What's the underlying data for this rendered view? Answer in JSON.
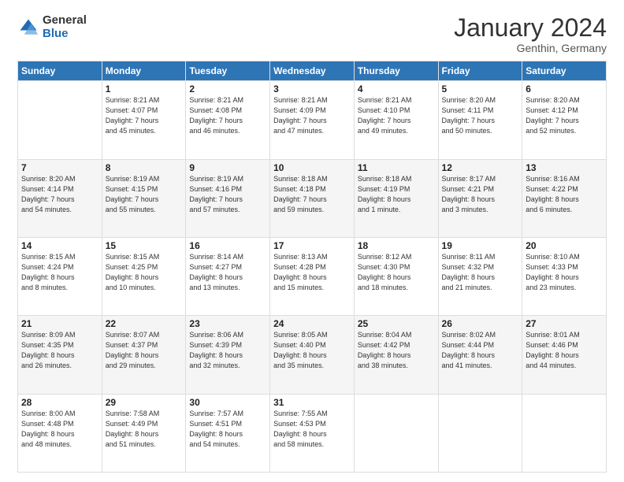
{
  "logo": {
    "general": "General",
    "blue": "Blue"
  },
  "title": "January 2024",
  "location": "Genthin, Germany",
  "days_header": [
    "Sunday",
    "Monday",
    "Tuesday",
    "Wednesday",
    "Thursday",
    "Friday",
    "Saturday"
  ],
  "weeks": [
    [
      {
        "day": "",
        "info": ""
      },
      {
        "day": "1",
        "info": "Sunrise: 8:21 AM\nSunset: 4:07 PM\nDaylight: 7 hours\nand 45 minutes."
      },
      {
        "day": "2",
        "info": "Sunrise: 8:21 AM\nSunset: 4:08 PM\nDaylight: 7 hours\nand 46 minutes."
      },
      {
        "day": "3",
        "info": "Sunrise: 8:21 AM\nSunset: 4:09 PM\nDaylight: 7 hours\nand 47 minutes."
      },
      {
        "day": "4",
        "info": "Sunrise: 8:21 AM\nSunset: 4:10 PM\nDaylight: 7 hours\nand 49 minutes."
      },
      {
        "day": "5",
        "info": "Sunrise: 8:20 AM\nSunset: 4:11 PM\nDaylight: 7 hours\nand 50 minutes."
      },
      {
        "day": "6",
        "info": "Sunrise: 8:20 AM\nSunset: 4:12 PM\nDaylight: 7 hours\nand 52 minutes."
      }
    ],
    [
      {
        "day": "7",
        "info": "Sunrise: 8:20 AM\nSunset: 4:14 PM\nDaylight: 7 hours\nand 54 minutes."
      },
      {
        "day": "8",
        "info": "Sunrise: 8:19 AM\nSunset: 4:15 PM\nDaylight: 7 hours\nand 55 minutes."
      },
      {
        "day": "9",
        "info": "Sunrise: 8:19 AM\nSunset: 4:16 PM\nDaylight: 7 hours\nand 57 minutes."
      },
      {
        "day": "10",
        "info": "Sunrise: 8:18 AM\nSunset: 4:18 PM\nDaylight: 7 hours\nand 59 minutes."
      },
      {
        "day": "11",
        "info": "Sunrise: 8:18 AM\nSunset: 4:19 PM\nDaylight: 8 hours\nand 1 minute."
      },
      {
        "day": "12",
        "info": "Sunrise: 8:17 AM\nSunset: 4:21 PM\nDaylight: 8 hours\nand 3 minutes."
      },
      {
        "day": "13",
        "info": "Sunrise: 8:16 AM\nSunset: 4:22 PM\nDaylight: 8 hours\nand 6 minutes."
      }
    ],
    [
      {
        "day": "14",
        "info": "Sunrise: 8:15 AM\nSunset: 4:24 PM\nDaylight: 8 hours\nand 8 minutes."
      },
      {
        "day": "15",
        "info": "Sunrise: 8:15 AM\nSunset: 4:25 PM\nDaylight: 8 hours\nand 10 minutes."
      },
      {
        "day": "16",
        "info": "Sunrise: 8:14 AM\nSunset: 4:27 PM\nDaylight: 8 hours\nand 13 minutes."
      },
      {
        "day": "17",
        "info": "Sunrise: 8:13 AM\nSunset: 4:28 PM\nDaylight: 8 hours\nand 15 minutes."
      },
      {
        "day": "18",
        "info": "Sunrise: 8:12 AM\nSunset: 4:30 PM\nDaylight: 8 hours\nand 18 minutes."
      },
      {
        "day": "19",
        "info": "Sunrise: 8:11 AM\nSunset: 4:32 PM\nDaylight: 8 hours\nand 21 minutes."
      },
      {
        "day": "20",
        "info": "Sunrise: 8:10 AM\nSunset: 4:33 PM\nDaylight: 8 hours\nand 23 minutes."
      }
    ],
    [
      {
        "day": "21",
        "info": "Sunrise: 8:09 AM\nSunset: 4:35 PM\nDaylight: 8 hours\nand 26 minutes."
      },
      {
        "day": "22",
        "info": "Sunrise: 8:07 AM\nSunset: 4:37 PM\nDaylight: 8 hours\nand 29 minutes."
      },
      {
        "day": "23",
        "info": "Sunrise: 8:06 AM\nSunset: 4:39 PM\nDaylight: 8 hours\nand 32 minutes."
      },
      {
        "day": "24",
        "info": "Sunrise: 8:05 AM\nSunset: 4:40 PM\nDaylight: 8 hours\nand 35 minutes."
      },
      {
        "day": "25",
        "info": "Sunrise: 8:04 AM\nSunset: 4:42 PM\nDaylight: 8 hours\nand 38 minutes."
      },
      {
        "day": "26",
        "info": "Sunrise: 8:02 AM\nSunset: 4:44 PM\nDaylight: 8 hours\nand 41 minutes."
      },
      {
        "day": "27",
        "info": "Sunrise: 8:01 AM\nSunset: 4:46 PM\nDaylight: 8 hours\nand 44 minutes."
      }
    ],
    [
      {
        "day": "28",
        "info": "Sunrise: 8:00 AM\nSunset: 4:48 PM\nDaylight: 8 hours\nand 48 minutes."
      },
      {
        "day": "29",
        "info": "Sunrise: 7:58 AM\nSunset: 4:49 PM\nDaylight: 8 hours\nand 51 minutes."
      },
      {
        "day": "30",
        "info": "Sunrise: 7:57 AM\nSunset: 4:51 PM\nDaylight: 8 hours\nand 54 minutes."
      },
      {
        "day": "31",
        "info": "Sunrise: 7:55 AM\nSunset: 4:53 PM\nDaylight: 8 hours\nand 58 minutes."
      },
      {
        "day": "",
        "info": ""
      },
      {
        "day": "",
        "info": ""
      },
      {
        "day": "",
        "info": ""
      }
    ]
  ]
}
